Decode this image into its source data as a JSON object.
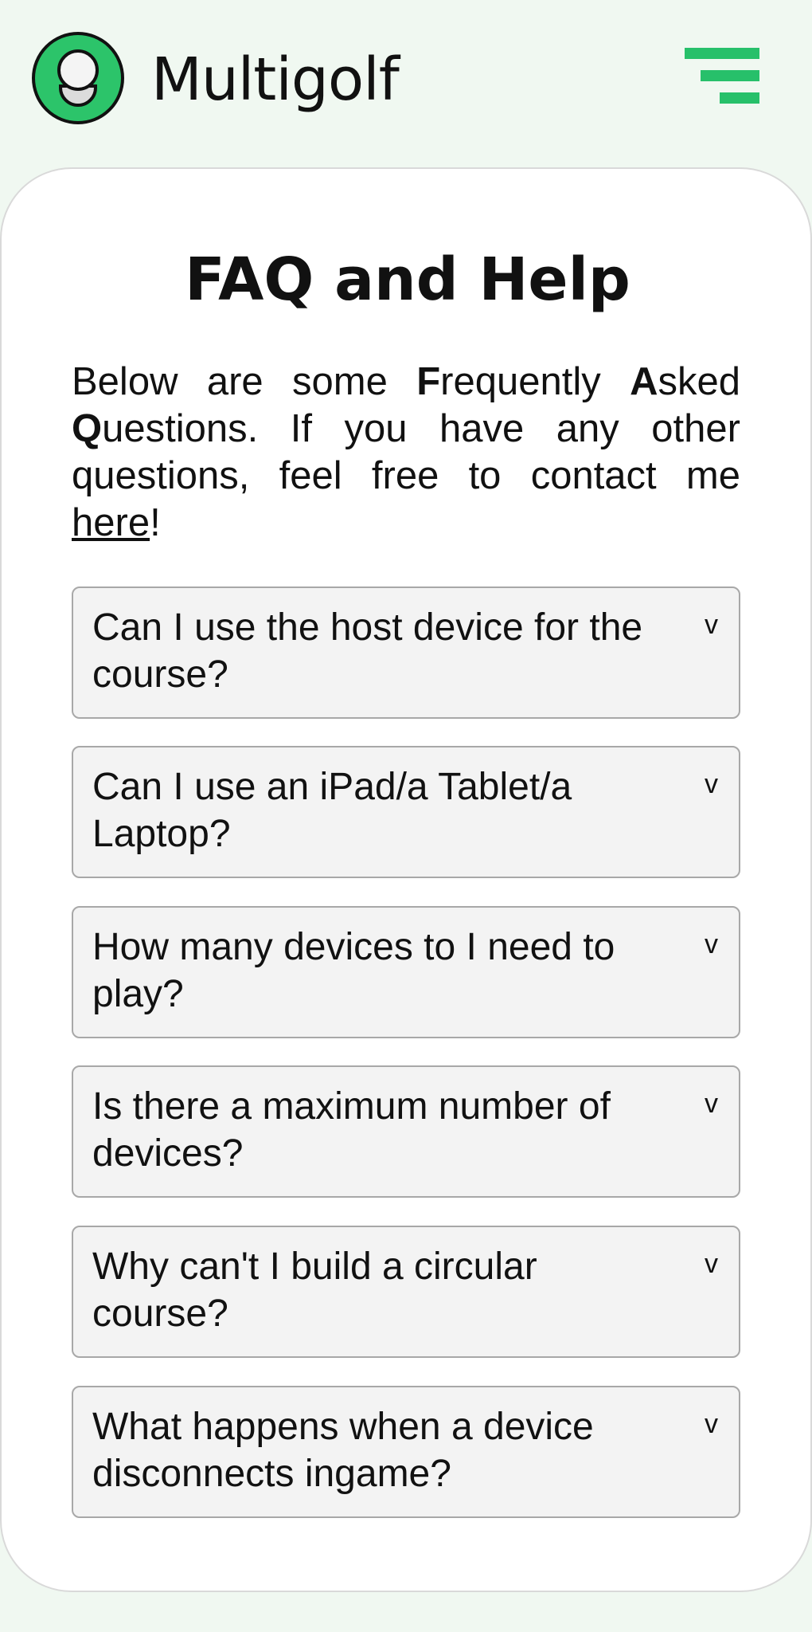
{
  "header": {
    "brand": "Multigolf",
    "logo_icon": "golf-ball-on-tee-icon",
    "menu_icon": "hamburger-menu-icon",
    "accent_color": "#2cc46a"
  },
  "page": {
    "title": "FAQ and Help",
    "intro": {
      "part1": "Below are some ",
      "bold_f": "F",
      "part2": "requently ",
      "bold_a": "A",
      "part3": "sked ",
      "bold_q": "Q",
      "part4": "uestions. If you have any other questions, feel free to contact me ",
      "link_text": "here",
      "part5": "!"
    }
  },
  "faq": {
    "chevron": "v",
    "items": [
      {
        "question": "Can I use the host device for the course?"
      },
      {
        "question": "Can I use an iPad/a Tablet/a Laptop?"
      },
      {
        "question": "How many devices to I need to play?"
      },
      {
        "question": "Is there a maximum number of devices?"
      },
      {
        "question": "Why can't I build a circular course?"
      },
      {
        "question": "What happens when a device disconnects ingame?"
      }
    ]
  }
}
